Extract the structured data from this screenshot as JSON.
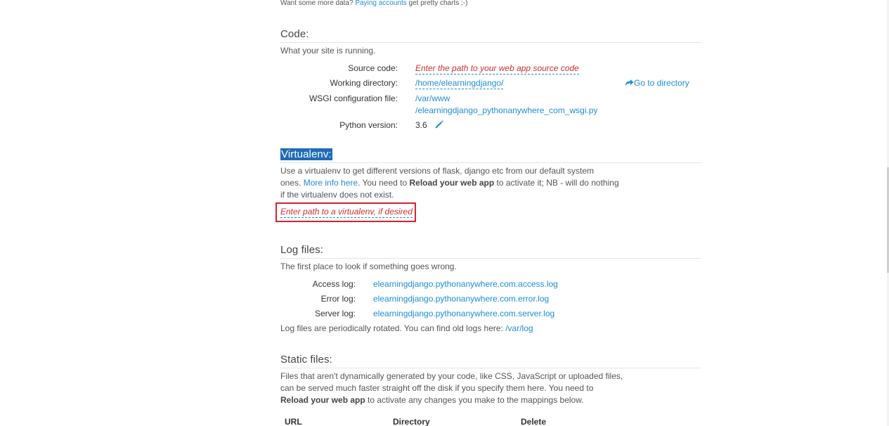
{
  "top": {
    "prefix": "Want some more data?",
    "link": "Paying accounts",
    "suffix": "get pretty charts ;-)"
  },
  "code": {
    "title": "Code:",
    "description": "What your site is running.",
    "source_label": "Source code:",
    "source_value": "Enter the path to your web app source code",
    "workdir_label": "Working directory:",
    "workdir_value": "/home/elearningdjango/",
    "goto_label": "Go to directory",
    "wsgi_label": "WSGI configuration file:",
    "wsgi_value_line1": "/var/www",
    "wsgi_value_line2": "/elearningdjango_pythonanywhere_com_wsgi.py",
    "python_label": "Python version:",
    "python_value": "3.6"
  },
  "virtualenv": {
    "title": "Virtualenv:",
    "desc_line1": "Use a virtualenv to get different versions of flask, django etc from our default system",
    "desc_line2_a": "ones.",
    "desc_line2_link": "More info here",
    "desc_line2_b": ". You need to",
    "desc_line2_bold": "Reload your web app",
    "desc_line2_c": "to activate it; NB - will do nothing",
    "desc_line3": "if the virtualenv does not exist.",
    "input_placeholder": "Enter path to a virtualenv, if desired"
  },
  "logs": {
    "title": "Log files:",
    "description": "The first place to look if something goes wrong.",
    "access_label": "Access log:",
    "access_value": "elearningdjango.pythonanywhere.com.access.log",
    "error_label": "Error log:",
    "error_value": "elearningdjango.pythonanywhere.com.error.log",
    "server_label": "Server log:",
    "server_value": "elearningdjango.pythonanywhere.com.server.log",
    "rotation_text": "Log files are periodically rotated. You can find old logs here:",
    "rotation_link": "/var/log"
  },
  "static": {
    "title": "Static files:",
    "desc_line1": "Files that aren't dynamically generated by your code, like CSS, JavaScript or uploaded files,",
    "desc_line2": "can be served much faster straight off the disk if you specify them here. You need to",
    "desc_line3_bold": "Reload your web app",
    "desc_line3_rest": "to activate any changes you make to the mappings below.",
    "col_url": "URL",
    "col_directory": "Directory",
    "col_delete": "Delete"
  },
  "colors": {
    "link": "#1f8dd6",
    "editable_placeholder": "#d32f2f",
    "highlight_box": "#d8212f",
    "selection": "#1f6bb8"
  }
}
